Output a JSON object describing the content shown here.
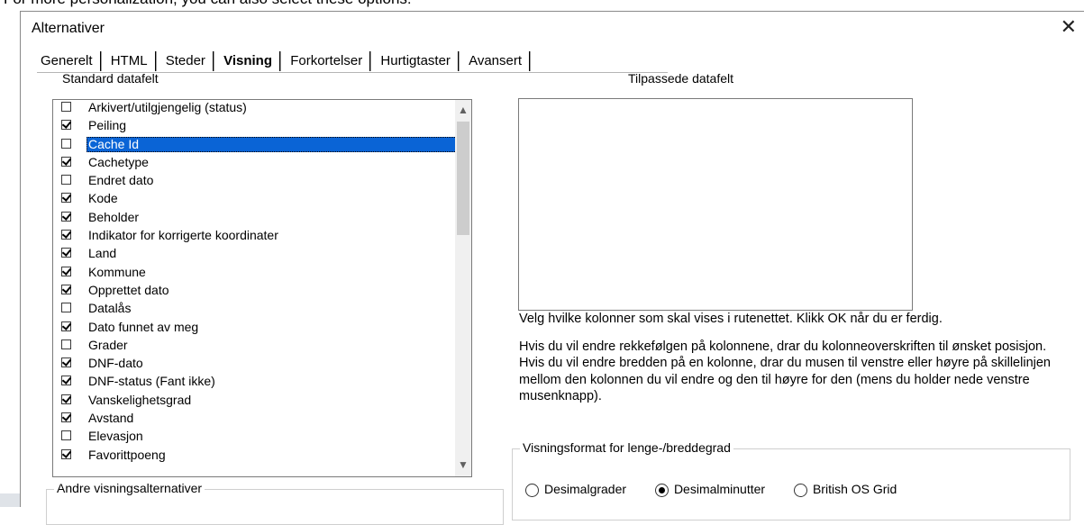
{
  "background_text": "For more personalization, you can also select these options:",
  "dialog": {
    "title": "Alternativer",
    "close_glyph": "✕"
  },
  "tabs": [
    {
      "label": "Generelt",
      "active": false
    },
    {
      "label": "HTML",
      "active": false
    },
    {
      "label": "Steder",
      "active": false
    },
    {
      "label": "Visning",
      "active": true
    },
    {
      "label": "Forkortelser",
      "active": false
    },
    {
      "label": "Hurtigtaster",
      "active": false
    },
    {
      "label": "Avansert",
      "active": false
    }
  ],
  "standard": {
    "label": "Standard datafelt",
    "items": [
      {
        "label": "Arkivert/utilgjengelig (status)",
        "checked": false
      },
      {
        "label": "Peiling",
        "checked": true
      },
      {
        "label": "Cache Id",
        "checked": false,
        "selected": true
      },
      {
        "label": "Cachetype",
        "checked": true
      },
      {
        "label": "Endret dato",
        "checked": false
      },
      {
        "label": "Kode",
        "checked": true
      },
      {
        "label": "Beholder",
        "checked": true
      },
      {
        "label": "Indikator for korrigerte koordinater",
        "checked": true
      },
      {
        "label": "Land",
        "checked": true
      },
      {
        "label": "Kommune",
        "checked": true
      },
      {
        "label": "Opprettet dato",
        "checked": true
      },
      {
        "label": "Datalås",
        "checked": false
      },
      {
        "label": "Dato funnet av meg",
        "checked": true
      },
      {
        "label": "Grader",
        "checked": false
      },
      {
        "label": "DNF-dato",
        "checked": true
      },
      {
        "label": "DNF-status (Fant ikke)",
        "checked": true
      },
      {
        "label": "Vanskelighetsgrad",
        "checked": true
      },
      {
        "label": "Avstand",
        "checked": true
      },
      {
        "label": "Elevasjon",
        "checked": false
      },
      {
        "label": "Favorittpoeng",
        "checked": true
      }
    ]
  },
  "custom": {
    "label": "Tilpassede datafelt"
  },
  "help": {
    "p1": "Velg hvilke kolonner som skal vises i rutenettet. Klikk OK når du er ferdig.",
    "p2": "Hvis du vil endre rekkefølgen på kolonnene, drar du kolonneoverskriften til ønsket posisjon. Hvis du vil endre bredden på en kolonne, drar du musen til venstre eller høyre på skillelinjen mellom den kolonnen du vil endre og den til høyre for den (mens du holder nede venstre musenknapp)."
  },
  "format": {
    "title": "Visningsformat for lenge-/breddegrad",
    "options": [
      {
        "label": "Desimalgrader",
        "selected": false
      },
      {
        "label": "Desimalminutter",
        "selected": true
      },
      {
        "label": "British OS Grid",
        "selected": false
      }
    ]
  },
  "other": {
    "title": "Andre visningsalternativer"
  },
  "icons": {
    "scroll_up": "▲",
    "scroll_down": "▼"
  }
}
